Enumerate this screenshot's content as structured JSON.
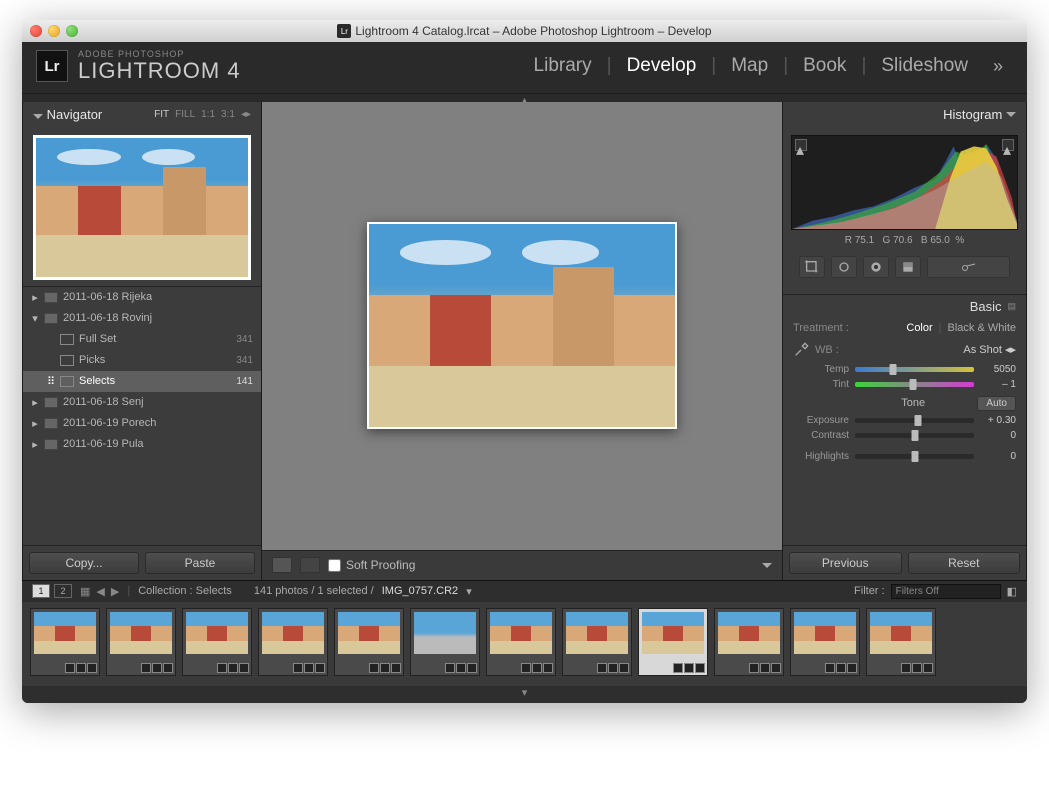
{
  "window_title": "Lightroom 4 Catalog.lrcat – Adobe Photoshop Lightroom – Develop",
  "brand": {
    "small": "ADOBE PHOTOSHOP",
    "large": "LIGHTROOM 4"
  },
  "modules": {
    "items": [
      "Library",
      "Develop",
      "Map",
      "Book",
      "Slideshow"
    ],
    "selected": "Develop"
  },
  "navigator": {
    "title": "Navigator",
    "zoom": {
      "fit": "FIT",
      "fill": "FILL",
      "one": "1:1",
      "three": "3:1"
    }
  },
  "folders": [
    {
      "name": "2011-06-18 Rijeka",
      "level": 0,
      "expanded": false
    },
    {
      "name": "2011-06-18 Rovinj",
      "level": 0,
      "expanded": true
    },
    {
      "name": "Full Set",
      "level": 1,
      "count": "341"
    },
    {
      "name": "Picks",
      "level": 1,
      "count": "341"
    },
    {
      "name": "Selects",
      "level": 1,
      "count": "141",
      "selected": true
    },
    {
      "name": "2011-06-18 Senj",
      "level": 0
    },
    {
      "name": "2011-06-19 Porech",
      "level": 0
    },
    {
      "name": "2011-06-19 Pula",
      "level": 0
    }
  ],
  "left_buttons": {
    "copy": "Copy...",
    "paste": "Paste"
  },
  "center_toolbar": {
    "soft_proof": "Soft Proofing"
  },
  "right_buttons": {
    "prev": "Previous",
    "reset": "Reset"
  },
  "histogram": {
    "title": "Histogram",
    "readout": {
      "r_lab": "R",
      "r": "75.1",
      "g_lab": "G",
      "g": "70.6",
      "b_lab": "B",
      "b": "65.0",
      "pct": "%"
    }
  },
  "basic_panel": {
    "title": "Basic",
    "treatment_label": "Treatment :",
    "treatment": {
      "color": "Color",
      "bw": "Black & White"
    },
    "wb_label": "WB :",
    "wb_value": "As Shot",
    "temp": {
      "label": "Temp",
      "value": "5050",
      "pos": 32
    },
    "tint": {
      "label": "Tint",
      "value": "– 1",
      "pos": 49
    },
    "tone_label": "Tone",
    "auto_label": "Auto",
    "exposure": {
      "label": "Exposure",
      "value": "+ 0.30",
      "pos": 53
    },
    "contrast": {
      "label": "Contrast",
      "value": "0",
      "pos": 50
    },
    "highlights": {
      "label": "Highlights",
      "value": "0",
      "pos": 50
    }
  },
  "filmstrip_bar": {
    "monitors": [
      "1",
      "2"
    ],
    "collection_label": "Collection : Selects",
    "count_text": "141 photos / 1 selected /",
    "filename": "IMG_0757.CR2",
    "filter_label": "Filter :",
    "filter_value": "Filters Off"
  }
}
